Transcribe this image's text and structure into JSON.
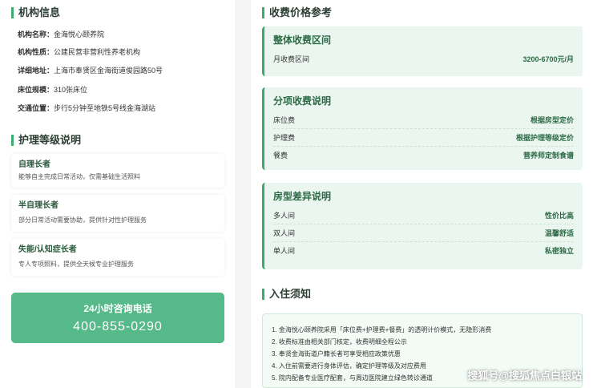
{
  "left": {
    "section_org": "机构信息",
    "info": [
      {
        "label": "机构名称：",
        "value": "金海悦心颐养院"
      },
      {
        "label": "机构性质：",
        "value": "公建民营非营利性养老机构"
      },
      {
        "label": "详细地址：",
        "value": "上海市奉贤区金海街道俊园路50号"
      },
      {
        "label": "床位规模：",
        "value": "310张床位"
      },
      {
        "label": "交通位置：",
        "value": "步行5分钟至地铁5号线金海湖站"
      }
    ],
    "section_care": "护理等级说明",
    "care": [
      {
        "title": "自理长者",
        "desc": "能够自主完成日常活动，仅需基础生活照料"
      },
      {
        "title": "半自理长者",
        "desc": "部分日常活动需要协助，提供针对性护理服务"
      },
      {
        "title": "失能/认知症长者",
        "desc": "专人专项照料，提供全天候专业护理服务"
      }
    ],
    "hotline_label": "24小时咨询电话",
    "hotline_number": "400-855-0290"
  },
  "right": {
    "section_price": "收费价格参考",
    "overall": {
      "title": "整体收费区间",
      "rows": [
        {
          "k": "月收费区间",
          "v": "3200-6700元/月"
        }
      ]
    },
    "items": {
      "title": "分项收费说明",
      "rows": [
        {
          "k": "床位费",
          "v": "根据房型定价"
        },
        {
          "k": "护理费",
          "v": "根据护理等级定价"
        },
        {
          "k": "餐费",
          "v": "营养师定制食谱"
        }
      ]
    },
    "rooms": {
      "title": "房型差异说明",
      "rows": [
        {
          "k": "多人间",
          "v": "性价比高"
        },
        {
          "k": "双人间",
          "v": "温馨舒适"
        },
        {
          "k": "单人间",
          "v": "私密独立"
        }
      ]
    },
    "section_notice": "入住须知",
    "notice": [
      "1. 金海悦心颐养院采用「床位费+护理费+餐费」的透明计价模式，无隐形消费",
      "2. 收费标准由相关部门核定，收费明细全程公示",
      "3. 奉贤金海街道户籍长者可享受相应政策优惠",
      "4. 入住前需要进行身体评估，确定护理等级及对应费用",
      "5. 院内配备专业医疗配套，与周边医院建立绿色转诊通道"
    ]
  },
  "watermark": "搜狐号@搜狐焦点白银站",
  "colors": {
    "accent": "#3bab6e",
    "hotline_bg": "#55b989",
    "card_bg": "#eaf6ef"
  }
}
